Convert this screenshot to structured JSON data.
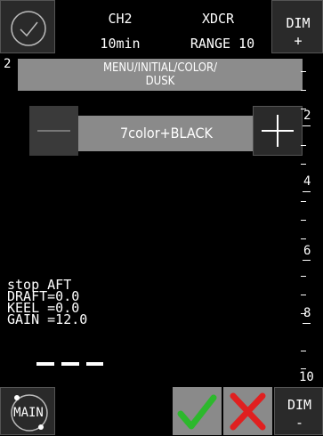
{
  "header": {
    "channel": "CH2",
    "time_range": "10min",
    "xdcr": "XDCR",
    "range": "RANGE 10",
    "dim_up_label": "DIM",
    "dim_up_sign": "+",
    "left_scale_value": "2"
  },
  "menu": {
    "path_line1": "MENU/INITIAL/COLOR/",
    "path_line2": "DUSK"
  },
  "color_setting": {
    "value": "7color+BLACK"
  },
  "depth_scale": [
    "2",
    "4",
    "6",
    "8",
    "10"
  ],
  "info": {
    "line1": "stop AFT",
    "line2": "DRAFT=0.0",
    "line3": "KEEL =0.0",
    "line4": "GAIN =12.0"
  },
  "footer": {
    "main_label": "MAIN",
    "dim_down_label": "DIM",
    "dim_down_sign": "-"
  },
  "colors": {
    "background": "#000000",
    "menu_bar": "#8c8c8c",
    "confirm": "#2db82d",
    "cancel": "#e02020",
    "button_dark": "#2a2a2a"
  }
}
